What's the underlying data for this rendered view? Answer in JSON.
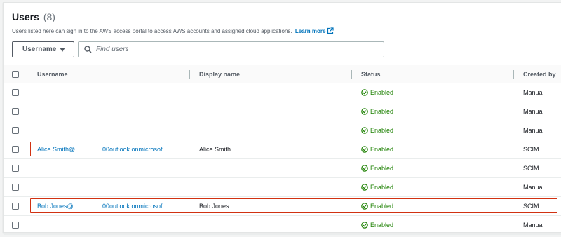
{
  "header": {
    "title": "Users",
    "count": "(8)",
    "description": "Users listed here can sign in to the AWS access portal to access AWS accounts and assigned cloud applications.",
    "learn_more": "Learn more"
  },
  "filter": {
    "property_label": "Username",
    "search_placeholder": "Find users"
  },
  "table": {
    "columns": [
      "Username",
      "Display name",
      "Status",
      "Created by"
    ],
    "rows": [
      {
        "username": "",
        "domain": "",
        "display_name": "",
        "status": "Enabled",
        "created_by": "Manual"
      },
      {
        "username": "",
        "domain": "",
        "display_name": "",
        "status": "Enabled",
        "created_by": "Manual"
      },
      {
        "username": "",
        "domain": "",
        "display_name": "",
        "status": "Enabled",
        "created_by": "Manual"
      },
      {
        "username": "Alice.Smith@",
        "domain": "00outlook.onmicrosof...",
        "display_name": "Alice Smith",
        "status": "Enabled",
        "created_by": "SCIM",
        "highlighted": true
      },
      {
        "username": "",
        "domain": "",
        "display_name": "",
        "status": "Enabled",
        "created_by": "SCIM"
      },
      {
        "username": "",
        "domain": "",
        "display_name": "",
        "status": "Enabled",
        "created_by": "Manual"
      },
      {
        "username": "Bob.Jones@",
        "domain": "00outlook.onmicrosoft....",
        "display_name": "Bob Jones",
        "status": "Enabled",
        "created_by": "SCIM",
        "highlighted": true
      },
      {
        "username": "",
        "domain": "",
        "display_name": "",
        "status": "Enabled",
        "created_by": "Manual"
      }
    ]
  },
  "colors": {
    "link": "#0073bb",
    "status_enabled": "#1d8102",
    "highlight_border": "#d13212"
  },
  "icons": {
    "external": "external-link-icon",
    "search": "search-icon",
    "status": "check-circle-icon",
    "dropdown": "caret-down-icon"
  }
}
